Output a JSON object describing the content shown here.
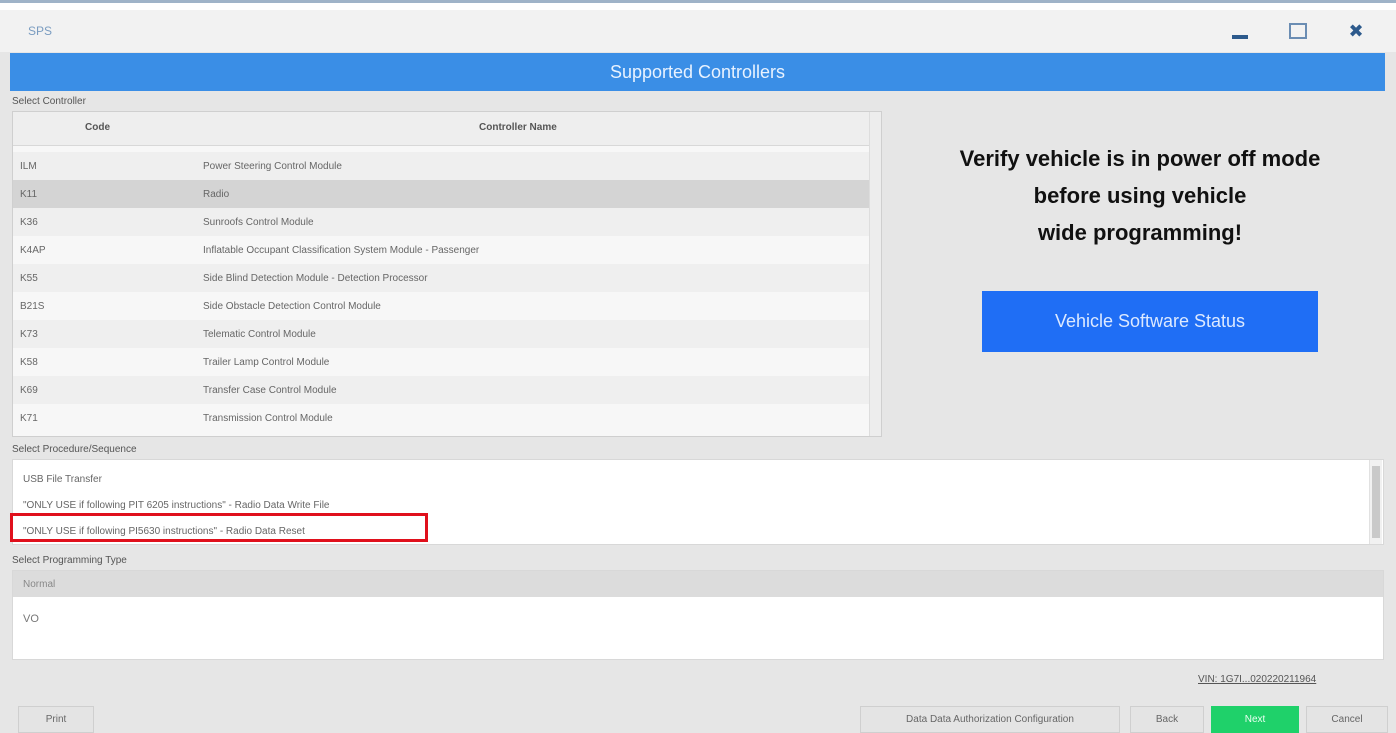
{
  "window": {
    "title": "SPS",
    "minimize_icon": "minimize-icon",
    "maximize_icon": "maximize-icon",
    "close_icon": "close-icon",
    "close_glyph": "✖"
  },
  "header": {
    "title": "Supported Controllers"
  },
  "controller_section": {
    "label": "Select Controller",
    "columns": {
      "code": "Code",
      "name": "Controller Name"
    },
    "rows": [
      {
        "code": "ILM",
        "name": "Power Steering Control Module"
      },
      {
        "code": "K11",
        "name": "Radio"
      },
      {
        "code": "K36",
        "name": "Sunroofs Control Module"
      },
      {
        "code": "K4AP",
        "name": "Inflatable Occupant Classification System Module - Passenger"
      },
      {
        "code": "K55",
        "name": "Side Blind Detection Module - Detection Processor"
      },
      {
        "code": "B21S",
        "name": "Side Obstacle Detection Control Module"
      },
      {
        "code": "K73",
        "name": "Telematic Control Module"
      },
      {
        "code": "K58",
        "name": "Trailer Lamp Control Module"
      },
      {
        "code": "K69",
        "name": "Transfer Case Control Module"
      },
      {
        "code": "K71",
        "name": "Transmission Control Module"
      }
    ],
    "selected_row_index": 1
  },
  "warning": {
    "lines": [
      "Verify vehicle is in power off mode",
      "before using vehicle",
      "wide programming!"
    ]
  },
  "vehicle_software_status_button": "Vehicle Software Status",
  "procedure_section": {
    "label": "Select Procedure/Sequence",
    "items": [
      "USB File Transfer",
      "\"ONLY USE if following PIT 6205 instructions\" - Radio Data Write File",
      "\"ONLY USE if following PI5630 instructions\" - Radio Data Reset"
    ],
    "highlighted_index": 2
  },
  "programming_type_section": {
    "label": "Select Programming Type",
    "header": "Normal",
    "value": "VO"
  },
  "version": "VIN: 1G7I...020220211964",
  "buttons": {
    "print": "Print",
    "oda_config": "Data Data Authorization Configuration",
    "back": "Back",
    "next": "Next",
    "cancel": "Cancel"
  },
  "colors": {
    "header_bg": "#3a8ee6",
    "vss_button_bg": "#1f6ef5",
    "next_button_bg": "#1fd16a",
    "highlight_border": "#e0101c"
  }
}
